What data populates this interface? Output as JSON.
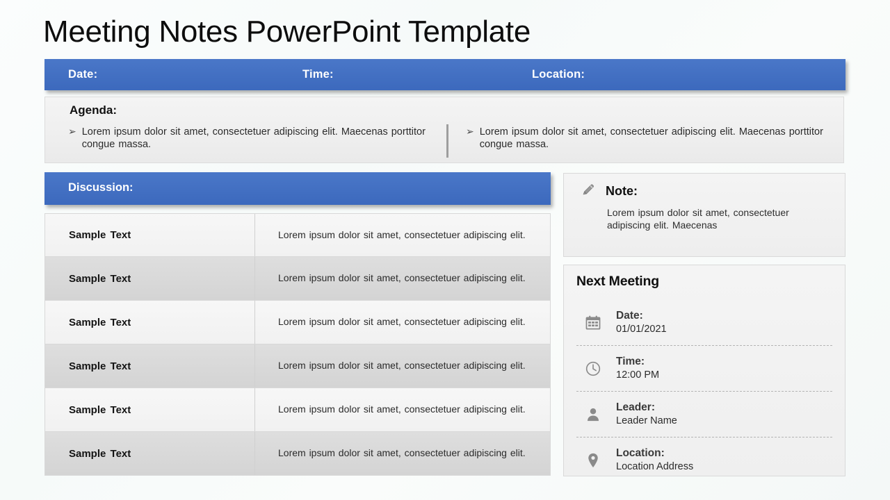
{
  "title": "Meeting Notes PowerPoint Template",
  "colors": {
    "accent_blue": "#3c69bd",
    "panel_gray": "#f1f1f1",
    "row_alt_gray": "#d8d8d8",
    "text_dark": "#141414",
    "icon_gray": "#8a8a8a"
  },
  "header_bar": {
    "date_label": "Date:",
    "time_label": "Time:",
    "location_label": "Location:"
  },
  "agenda": {
    "heading": "Agenda:",
    "bullet_glyph": "➢",
    "items": [
      "Lorem ipsum dolor sit amet, consectetuer adipiscing elit. Maecenas porttitor congue massa.",
      "Lorem ipsum dolor sit amet, consectetuer adipiscing elit. Maecenas porttitor congue massa."
    ]
  },
  "discussion": {
    "heading": "Discussion:",
    "rows": [
      {
        "label": "Sample Text",
        "text": "Lorem ipsum dolor sit amet, consectetuer adipiscing elit."
      },
      {
        "label": "Sample Text",
        "text": "Lorem ipsum dolor sit amet, consectetuer adipiscing elit."
      },
      {
        "label": "Sample Text",
        "text": "Lorem ipsum dolor sit amet, consectetuer adipiscing elit."
      },
      {
        "label": "Sample Text",
        "text": "Lorem ipsum dolor sit amet, consectetuer adipiscing elit."
      },
      {
        "label": "Sample Text",
        "text": "Lorem ipsum dolor sit amet, consectetuer adipiscing elit."
      },
      {
        "label": "Sample Text",
        "text": "Lorem ipsum dolor sit amet, consectetuer adipiscing elit."
      }
    ]
  },
  "note": {
    "icon": "pencil-icon",
    "heading": "Note:",
    "body": "Lorem ipsum dolor sit amet, consectetuer adipiscing elit. Maecenas"
  },
  "next_meeting": {
    "heading": "Next Meeting",
    "items": [
      {
        "icon": "calendar-icon",
        "label": "Date:",
        "value": "01/01/2021"
      },
      {
        "icon": "clock-icon",
        "label": "Time:",
        "value": "12:00 PM"
      },
      {
        "icon": "person-icon",
        "label": "Leader:",
        "value": "Leader Name"
      },
      {
        "icon": "pin-icon",
        "label": "Location:",
        "value": "Location Address"
      }
    ]
  }
}
